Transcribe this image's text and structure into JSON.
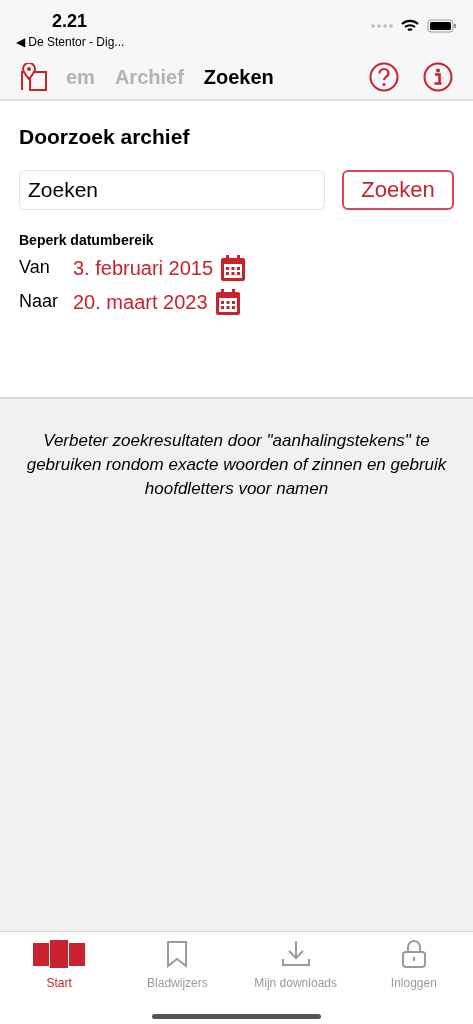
{
  "status_bar": {
    "time": "2.21",
    "back_app": "◀ De Stentor - Dig..."
  },
  "nav_tabs": [
    {
      "label": "em",
      "selected": false
    },
    {
      "label": "Archief",
      "selected": false
    },
    {
      "label": "Zoeken",
      "selected": true
    }
  ],
  "search": {
    "title": "Doorzoek archief",
    "value": "Zoeken",
    "button": "Zoeken"
  },
  "date_range": {
    "label": "Beperk datumbereik",
    "rows": [
      {
        "label": "Van",
        "date": "3. februari 2015"
      },
      {
        "label": "Naar",
        "date": "20. maart 2023"
      }
    ]
  },
  "hint": "Verbeter zoekresultaten door \"aanhalingstekens\" te gebruiken rondom exacte woorden of zinnen en gebruik hoofdletters voor namen",
  "tab_bar": [
    {
      "kind": "start",
      "label": "Start",
      "selected": true
    },
    {
      "kind": "bookmark",
      "label": "Bladwijzers",
      "selected": false
    },
    {
      "kind": "download",
      "label": "Mijn downloads",
      "selected": false
    },
    {
      "kind": "lock",
      "label": "Inloggen",
      "selected": false
    }
  ]
}
